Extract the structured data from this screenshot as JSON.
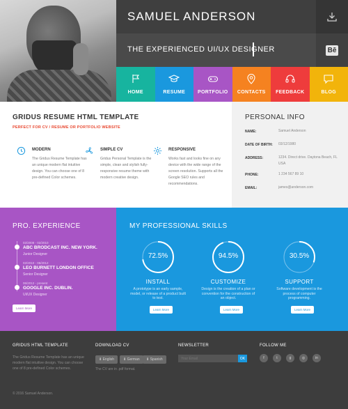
{
  "header": {
    "name": "SAMUEL ANDERSON",
    "subtitle": "THE EXPERIENCED UI/UX DESIGNER",
    "behance_label": "Bē"
  },
  "nav": [
    {
      "label": "HOME",
      "icon": "flag-icon",
      "color": "#17b49f"
    },
    {
      "label": "RESUME",
      "icon": "graduation-cap-icon",
      "color": "#1a98de"
    },
    {
      "label": "PORTFOLIO",
      "icon": "gamepad-icon",
      "color": "#a855c5"
    },
    {
      "label": "CONTACTS",
      "icon": "map-pin-icon",
      "color": "#f58220"
    },
    {
      "label": "FEEDBACK",
      "icon": "headset-icon",
      "color": "#ee3c3c"
    },
    {
      "label": "BLOG",
      "icon": "chat-icon",
      "color": "#f2b40b"
    }
  ],
  "template": {
    "title": "GRIDUS RESUME HTML TEMPLATE",
    "subtitle": "PERFECT FOR CV / RESUME OR PORTFOLIO WEBSITE",
    "features": [
      {
        "icon": "clock-icon",
        "title": "MODERN",
        "desc": "The Gridus Resume Template has an unique modern flat intuitive design. You can choose one of 8 pre-defined Color schemes."
      },
      {
        "icon": "fan-icon",
        "title": "SIMPLE CV",
        "desc": "Gridus Personal Template is the simple, clean and stylish fully-responsive resume theme with modern creative design."
      },
      {
        "icon": "gear-icon",
        "title": "RESPONSIVE",
        "desc": "Works fast and looks fine on any device with the wide range of the screen resolution. Supports all the Google SEO rules and recommendations."
      }
    ]
  },
  "info": {
    "title": "PERSONAL INFO",
    "rows": [
      {
        "label": "NAME:",
        "value": "Samuel Anderson"
      },
      {
        "label": "DATE OF BIRTH:",
        "value": "03/12/1980"
      },
      {
        "label": "ADDRESS:",
        "value": "1234. Direct drive. Daytona Beach, FL USA"
      },
      {
        "label": "PHONE:",
        "value": "1 234 567 89 10"
      },
      {
        "label": "EMAIL:",
        "value": "james@anderson.com"
      }
    ]
  },
  "experience": {
    "title": "PRO. EXPERIENCE",
    "items": [
      {
        "date": "02/2008 - 02/2010",
        "company": "ABC BRODCAST INC. NEW YORK.",
        "role": "Junior Designer"
      },
      {
        "date": "02/2010 - 06/2012",
        "company": "LEO BURNETT LONDON OFFICE",
        "role": "Senior Designer"
      },
      {
        "date": "06/2012 - present",
        "company": "GOOGLE INC. DUBLIN.",
        "role": "UI/UX Designer"
      }
    ],
    "button": "Learn More"
  },
  "skills": {
    "title": "MY PROFESSIONAL SKILLS",
    "items": [
      {
        "percent": "72.5%",
        "value": 0.725,
        "name": "INSTALL",
        "desc": "A prototype is an early sample, model, or release of a product built to test.",
        "button": "Learn More"
      },
      {
        "percent": "94.5%",
        "value": 0.945,
        "name": "CUSTOMIZE",
        "desc": "Design is the creation of a plan or convention for the construction of an object.",
        "button": "Learn More"
      },
      {
        "percent": "30.5%",
        "value": 0.305,
        "name": "SUPPORT",
        "desc": "Software development is the process of computer programming.",
        "button": "Learn More"
      }
    ]
  },
  "footer": {
    "col1_title": "GRIDUS HTML TEMPLATE",
    "col1_desc": "The Gridus Resume Template has an unique modern flat intuitive design. You can choose one of 8 pre-defined Color schemes.",
    "col2_title": "DOWNLOAD CV",
    "langs": [
      "English",
      "German",
      "Spanish"
    ],
    "cv_note": "The CV are in .pdf format.",
    "col3_title": "NEWSLETTER",
    "email_placeholder": "Your Email",
    "ok_label": "OK",
    "col4_title": "FOLLOW ME",
    "social": [
      "facebook-icon",
      "twitter-icon",
      "google-plus-icon",
      "dribbble-icon",
      "linkedin-icon",
      "youtube-icon"
    ],
    "copyright": "© 2016 Samuel Anderson."
  }
}
